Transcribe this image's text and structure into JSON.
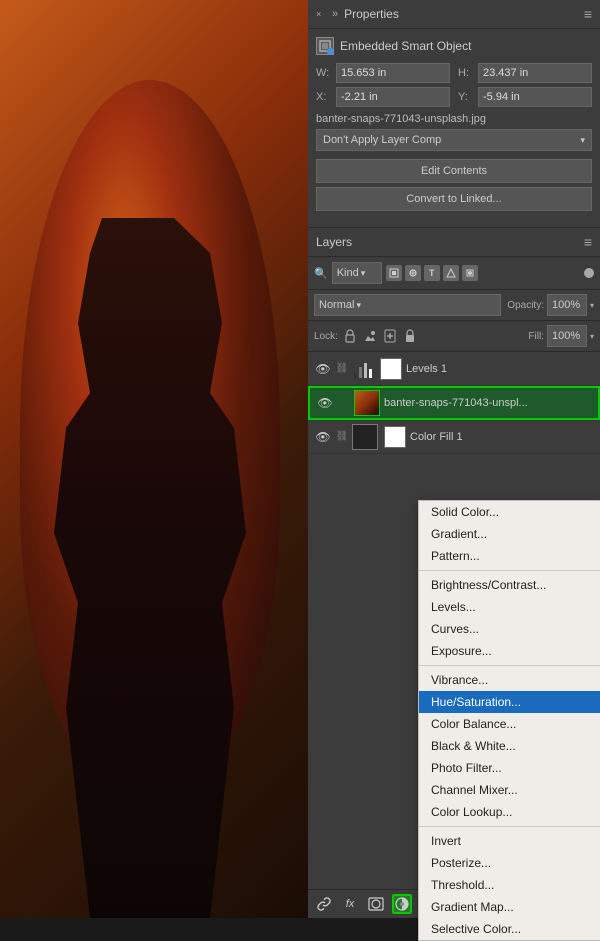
{
  "background": {
    "alt": "Dark silhouette portrait with orange background"
  },
  "properties_panel": {
    "title": "Properties",
    "close_label": "×",
    "expand_label": "»",
    "smart_object_label": "Embedded Smart Object",
    "width_label": "W:",
    "width_value": "15.653 in",
    "height_label": "H:",
    "height_value": "23.437 in",
    "x_label": "X:",
    "x_value": "-2.21 in",
    "y_label": "Y:",
    "y_value": "-5.94 in",
    "filename": "banter-snaps-771043-unsplash.jpg",
    "layer_comp_label": "Don't Apply Layer Comp",
    "edit_contents_label": "Edit Contents",
    "convert_linked_label": "Convert to Linked..."
  },
  "layers_panel": {
    "title": "Layers",
    "kind_label": "Kind",
    "blend_mode": "Normal",
    "opacity_label": "Opacity:",
    "opacity_value": "100%",
    "lock_label": "Lock:",
    "fill_label": "Fill:",
    "fill_value": "100%",
    "layers": [
      {
        "name": "Levels 1",
        "type": "adjustment",
        "visible": true
      },
      {
        "name": "banter-snaps-771043-unspl...",
        "type": "smart_object",
        "visible": true,
        "selected": true
      },
      {
        "name": "Color Fill 1",
        "type": "fill",
        "visible": true
      }
    ],
    "bottom_tools": [
      {
        "icon": "🔗",
        "name": "link"
      },
      {
        "icon": "fx",
        "name": "effects"
      },
      {
        "icon": "◉",
        "name": "mask"
      },
      {
        "icon": "⊕",
        "name": "adjustment",
        "active": true
      },
      {
        "icon": "📁",
        "name": "group"
      },
      {
        "icon": "📋",
        "name": "new-layer"
      },
      {
        "icon": "🗑",
        "name": "delete"
      }
    ]
  },
  "adjustment_menu": {
    "items": [
      {
        "label": "Solid Color...",
        "group": 1
      },
      {
        "label": "Gradient...",
        "group": 1
      },
      {
        "label": "Pattern...",
        "group": 1
      },
      {
        "label": "Brightness/Contrast...",
        "group": 2
      },
      {
        "label": "Levels...",
        "group": 2
      },
      {
        "label": "Curves...",
        "group": 2
      },
      {
        "label": "Exposure...",
        "group": 2
      },
      {
        "label": "Vibrance...",
        "group": 3
      },
      {
        "label": "Hue/Saturation...",
        "group": 3,
        "active": true
      },
      {
        "label": "Color Balance...",
        "group": 3
      },
      {
        "label": "Black & White...",
        "group": 3
      },
      {
        "label": "Photo Filter...",
        "group": 3
      },
      {
        "label": "Channel Mixer...",
        "group": 3
      },
      {
        "label": "Color Lookup...",
        "group": 3
      },
      {
        "label": "Invert",
        "group": 4
      },
      {
        "label": "Posterize...",
        "group": 4
      },
      {
        "label": "Threshold...",
        "group": 4
      },
      {
        "label": "Gradient Map...",
        "group": 4
      },
      {
        "label": "Selective Color...",
        "group": 4
      }
    ]
  }
}
